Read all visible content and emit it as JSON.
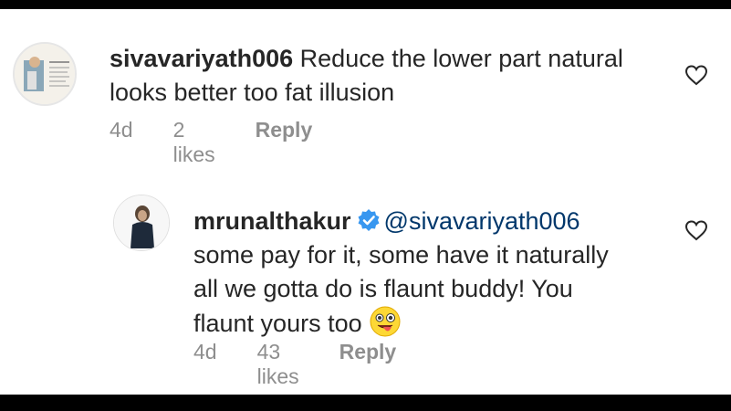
{
  "comment1": {
    "username": "sivavariyath006",
    "text": " Reduce the lower part natural looks better too fat illusion",
    "age": "4d",
    "likes": "2 likes",
    "reply_label": "Reply"
  },
  "comment2": {
    "username": "mrunalthakur",
    "mention": "@sivavariyath006",
    "text": "some pay for it, some have it naturally all we gotta do is flaunt buddy! You flaunt yours too",
    "age": "4d",
    "likes": "43 likes",
    "reply_label": "Reply"
  },
  "icons": {
    "like": "heart-outline-icon",
    "verified": "verified-badge-icon",
    "emoji": "winking-face-with-tongue-emoji"
  },
  "colors": {
    "text": "#262626",
    "meta": "#8e8e8e",
    "verified": "#3897f0",
    "mention": "#00376b"
  }
}
